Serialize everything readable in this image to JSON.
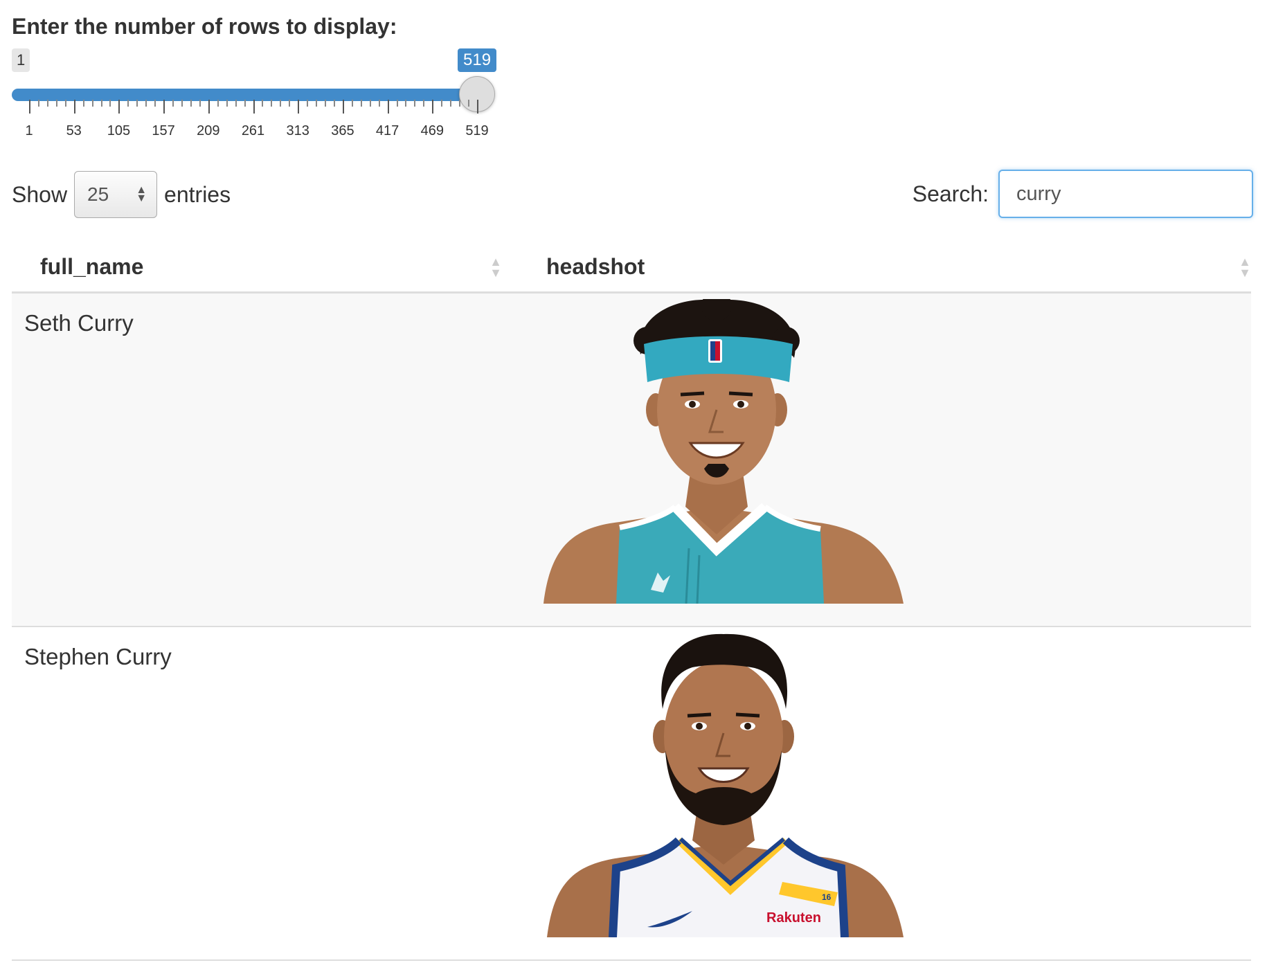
{
  "slider": {
    "label": "Enter the number of rows to display:",
    "min": 1,
    "max": 519,
    "value": 519,
    "min_label": "1",
    "value_label": "519",
    "tick_labels": [
      "1",
      "53",
      "105",
      "157",
      "209",
      "261",
      "313",
      "365",
      "417",
      "469",
      "519"
    ]
  },
  "length": {
    "prefix": "Show",
    "value": "25",
    "suffix": "entries"
  },
  "search": {
    "label": "Search:",
    "value": "curry"
  },
  "table": {
    "columns": [
      "full_name",
      "headshot"
    ],
    "rows": [
      {
        "full_name": "Seth Curry",
        "headshot": "headshot-seth-curry"
      },
      {
        "full_name": "Stephen Curry",
        "headshot": "headshot-stephen-curry"
      }
    ]
  },
  "jersey_text": {
    "number": "16",
    "sponsor": "Rakuten"
  },
  "colors": {
    "accent": "#428bca",
    "search_focus": "#66afe9",
    "hornets_teal": "#2fa7b7",
    "warriors_blue": "#1d428a",
    "warriors_gold": "#ffc72c"
  }
}
